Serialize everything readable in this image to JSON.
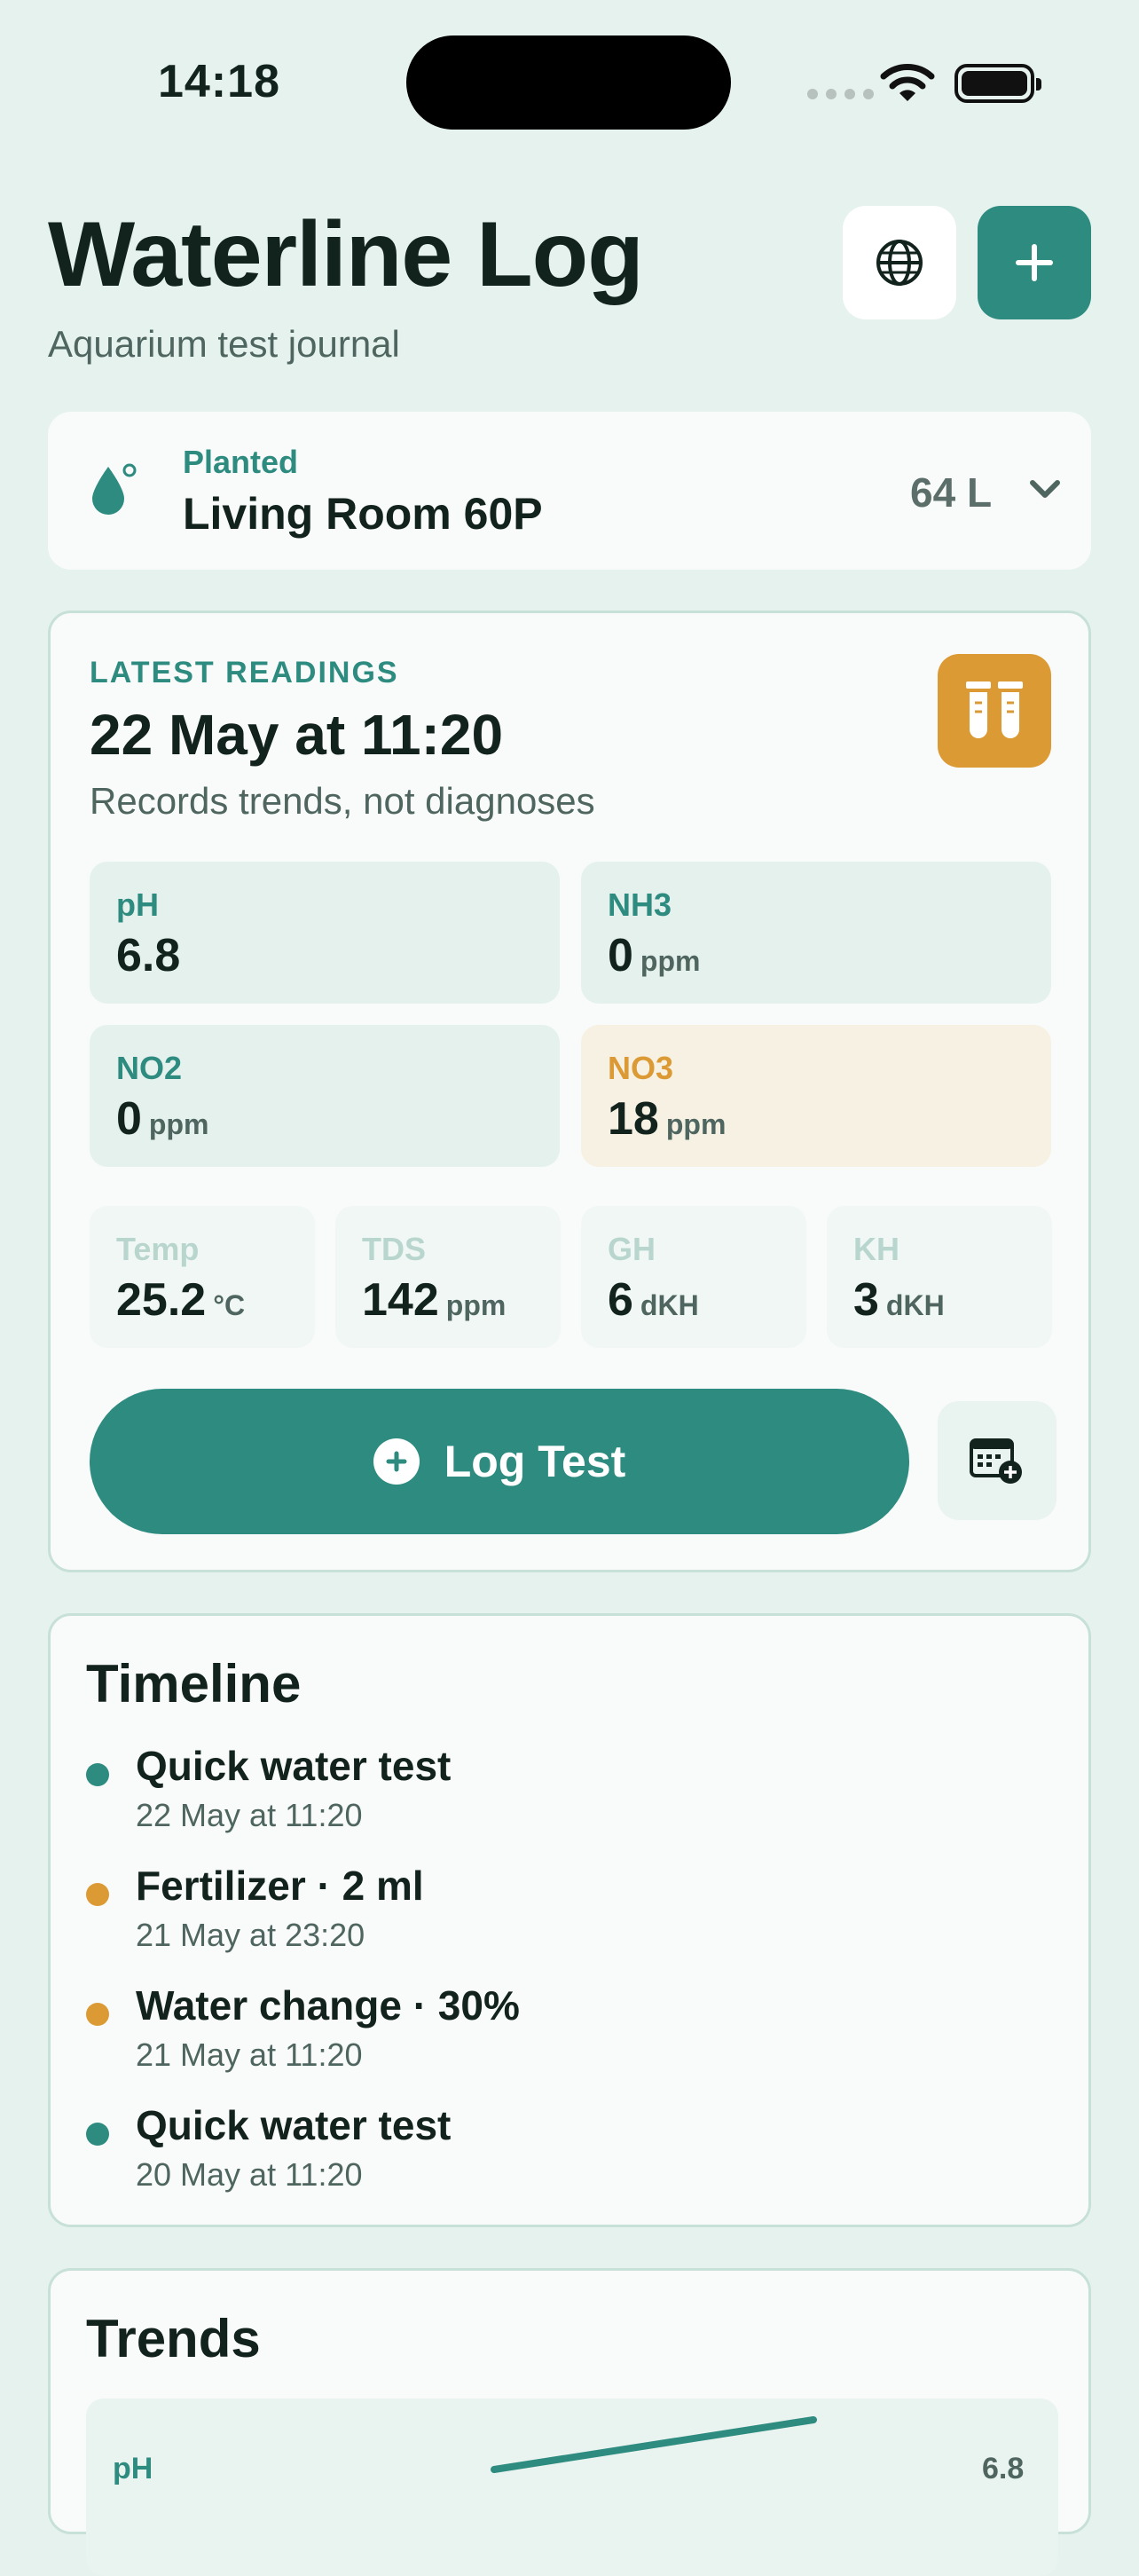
{
  "status_bar": {
    "time": "14:18"
  },
  "header": {
    "title": "Waterline Log",
    "subtitle": "Aquarium test journal"
  },
  "tank": {
    "type": "Planted",
    "name": "Living Room 60P",
    "volume": "64 L"
  },
  "latest": {
    "label": "LATEST READINGS",
    "date": "22 May at 11:20",
    "note": "Records trends, not diagnoses",
    "primary": [
      {
        "name": "pH",
        "value": "6.8",
        "unit": ""
      },
      {
        "name": "NH3",
        "value": "0",
        "unit": "ppm"
      },
      {
        "name": "NO2",
        "value": "0",
        "unit": "ppm"
      },
      {
        "name": "NO3",
        "value": "18",
        "unit": "ppm"
      }
    ],
    "secondary": [
      {
        "name": "Temp",
        "value": "25.2",
        "unit": "°C"
      },
      {
        "name": "TDS",
        "value": "142",
        "unit": "ppm"
      },
      {
        "name": "GH",
        "value": "6",
        "unit": "dKH"
      },
      {
        "name": "KH",
        "value": "3",
        "unit": "dKH"
      }
    ],
    "log_button": "Log Test"
  },
  "timeline": {
    "title": "Timeline",
    "items": [
      {
        "title": "Quick water test",
        "time": "22 May at 11:20",
        "color": "#2e8b80"
      },
      {
        "title": "Fertilizer · 2 ml",
        "time": "21 May at 23:20",
        "color": "#dc9a35"
      },
      {
        "title": "Water change · 30%",
        "time": "21 May at 11:20",
        "color": "#dc9a35"
      },
      {
        "title": "Quick water test",
        "time": "20 May at 11:20",
        "color": "#2e8b80"
      }
    ]
  },
  "trends": {
    "title": "Trends",
    "series_label": "pH",
    "latest_value": "6.8"
  },
  "colors": {
    "accent": "#2e8b80",
    "warning": "#dc9a35",
    "background": "#e6f2ee"
  },
  "icons": {
    "globe": "globe-icon",
    "add": "plus-icon",
    "drop": "water-drop-icon",
    "tubes": "test-tubes-icon",
    "calendar": "calendar-add-icon"
  }
}
